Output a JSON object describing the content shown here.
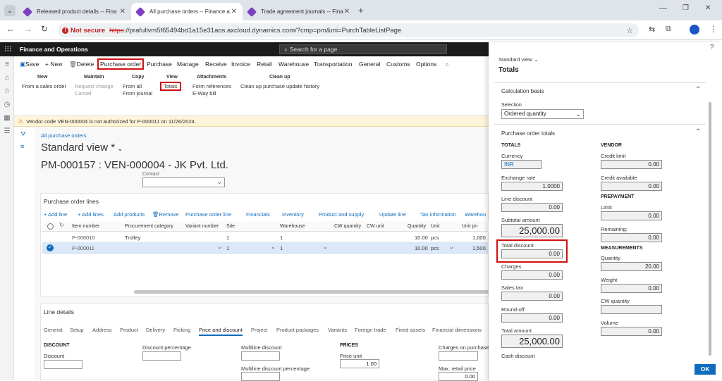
{
  "browser": {
    "tabs": [
      {
        "label": "Released product details -- Fina"
      },
      {
        "label": "All purchase orders -- Finance a"
      },
      {
        "label": "Trade agreement journals -- Fina"
      }
    ],
    "not_secure": "Not secure",
    "url_scheme": "https",
    "url_rest": "://prafullvm5f65494bd1a15e31aos.axcloud.dynamics.com/?cmp=pm&mi=PurchTableListPage"
  },
  "app": {
    "name": "Finance and Operations",
    "search_placeholder": "Search for a page"
  },
  "action_pane": {
    "menus": {
      "save": "Save",
      "new": "+ New",
      "delete": "Delete",
      "purchase_order": "Purchase order",
      "purchase": "Purchase",
      "manage": "Manage",
      "receive": "Receive",
      "invoice": "Invoice",
      "retail": "Retail",
      "warehouse": "Warehouse",
      "transportation": "Transportation",
      "general": "General",
      "customs": "Customs",
      "options": "Options"
    },
    "groups": {
      "new": {
        "header": "New",
        "items": [
          "From a sales order"
        ]
      },
      "maintain": {
        "header": "Maintain",
        "items": [
          "Request change",
          "Cancel"
        ]
      },
      "copy": {
        "header": "Copy",
        "items": [
          "From all",
          "From journal"
        ]
      },
      "view": {
        "header": "View",
        "items": [
          "Totals"
        ]
      },
      "attachments": {
        "header": "Attachments",
        "items": [
          "Form references",
          "E-Way bill"
        ]
      },
      "cleanup": {
        "header": "Clean up",
        "items": [
          "Clean up purchase update history"
        ]
      }
    }
  },
  "warning": "Vendor code VEN-000004 is not authorized for P-000011 on 11/26/2024.",
  "main": {
    "breadcrumb": "All purchase orders",
    "view_name": "Standard view *",
    "record_title": "PM-000157 : VEN-000004 - JK Pvt. Ltd.",
    "contact_label": "Contact",
    "lines_title": "Purchase order lines",
    "lines_toolbar": [
      "+ Add line",
      "+ Add lines",
      "Add products",
      "Remove",
      "Purchase order line",
      "Financials",
      "Inventory",
      "Product and supply",
      "Update line",
      "Tax information",
      "Warehou"
    ],
    "columns": [
      "Item number",
      "Procurement category",
      "Variant number",
      "Site",
      "Warehouse",
      "CW quantity",
      "CW unit",
      "Quantity",
      "Unit",
      "Unit pri"
    ],
    "rows": [
      {
        "item": "P-000010",
        "category": "Trolley",
        "variant": "",
        "site": "1",
        "warehouse": "1",
        "cwq": "",
        "cwu": "",
        "qty": "10.00",
        "unit": "pcs",
        "price": "1,000."
      },
      {
        "item": "P-000011",
        "category": "",
        "variant": "",
        "site": "1",
        "warehouse": "1",
        "cwq": "",
        "cwu": "",
        "qty": "10.00",
        "unit": "pcs",
        "price": "1,500."
      }
    ],
    "line_details_title": "Line details",
    "detail_tabs": [
      "General",
      "Setup",
      "Address",
      "Product",
      "Delivery",
      "Picking",
      "Price and discount",
      "Project",
      "Product packages",
      "Variants",
      "Foreign trade",
      "Fixed assets",
      "Financial dimensions"
    ],
    "discount_header": "DISCOUNT",
    "discount_label": "Discount",
    "discount_pct_label": "Discount percentage",
    "multiline_label": "Multiline discount",
    "multiline_pct_label": "Multiline discount percentage",
    "prices_header": "PRICES",
    "price_unit_label": "Price unit",
    "price_unit_value": "1.00",
    "charges_label": "Charges on purchases",
    "max_retail_label": "Max. retail price",
    "max_retail_value": "0.00"
  },
  "panel": {
    "view_label": "Standard view",
    "title": "Totals",
    "calc_header": "Calculation basis",
    "selection_label": "Selection",
    "selection_value": "Ordered quantity",
    "totals_header": "Purchase order totals",
    "totals_group": "TOTALS",
    "currency_label": "Currency",
    "currency_value": "INR",
    "exrate_label": "Exchange rate",
    "exrate_value": "1.0000",
    "linedisc_label": "Line discount",
    "linedisc_value": "0.00",
    "subtotal_label": "Subtotal amount",
    "subtotal_value": "25,000.00",
    "totaldisc_label": "Total discount",
    "totaldisc_value": "0.00",
    "charges_label": "Charges",
    "charges_value": "0.00",
    "salestax_label": "Sales tax",
    "salestax_value": "0.00",
    "roundoff_label": "Round-off",
    "roundoff_value": "0.00",
    "totalamt_label": "Total amount",
    "totalamt_value": "25,000.00",
    "cashdisc_label": "Cash discount",
    "vendor_group": "VENDOR",
    "credit_label": "Credit limit",
    "credit_value": "0.00",
    "creditavail_label": "Credit available",
    "creditavail_value": "0.00",
    "prepay_group": "PREPAYMENT",
    "limit_label": "Limit",
    "limit_value": "0.00",
    "remaining_label": "Remaining:",
    "remaining_value": "0.00",
    "meas_group": "MEASUREMENTS",
    "quantity_label": "Quantity",
    "quantity_value": "20.00",
    "weight_label": "Weight",
    "weight_value": "0.00",
    "cwq_label": "CW quantity",
    "cwq_value": "",
    "volume_label": "Volume",
    "volume_value": "0.00",
    "ok_label": "OK",
    "help": "?"
  }
}
